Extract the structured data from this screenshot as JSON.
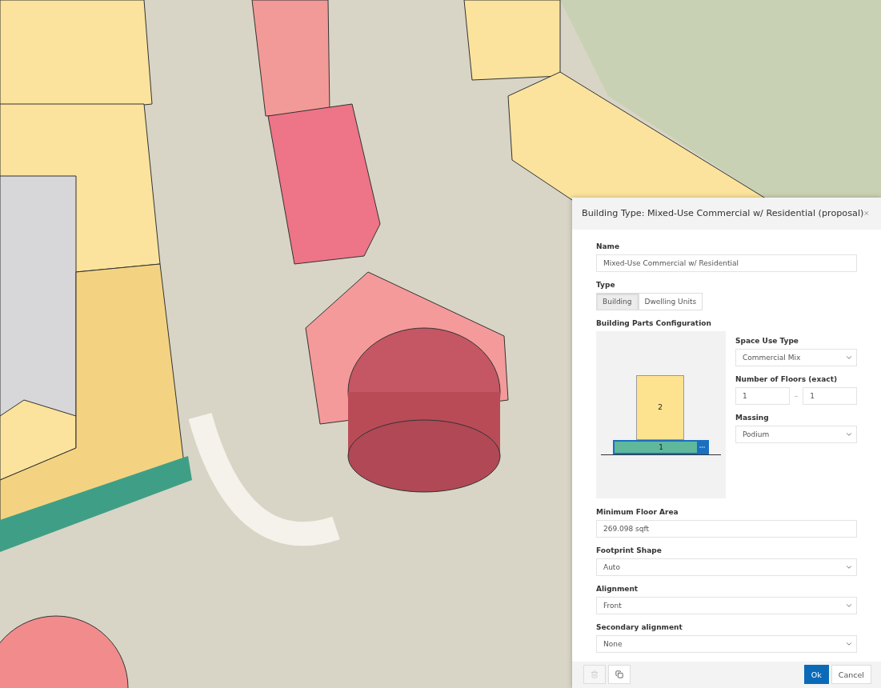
{
  "dialog": {
    "title": "Building Type: Mixed-Use Commercial w/ Residential (proposal)",
    "name": {
      "label": "Name",
      "value": "Mixed-Use Commercial w/ Residential"
    },
    "type": {
      "label": "Type",
      "options": [
        {
          "label": "Building",
          "selected": true
        },
        {
          "label": "Dwelling Units",
          "selected": false
        }
      ]
    },
    "configuration": {
      "label": "Building Parts Configuration",
      "parts": [
        {
          "label": "2",
          "color": "#fde28f",
          "selected": false
        },
        {
          "label": "1",
          "color": "#5fb89b",
          "selected": true
        }
      ],
      "space_use": {
        "label": "Space Use Type",
        "value": "Commercial Mix"
      },
      "floors": {
        "label": "Number of Floors (exact)",
        "min": "1",
        "separator": "–",
        "max": "1"
      },
      "massing": {
        "label": "Massing",
        "value": "Podium"
      }
    },
    "min_floor_area": {
      "label": "Minimum Floor Area",
      "value": "269.098 sqft"
    },
    "selects": [
      {
        "label": "Footprint Shape",
        "value": "Auto"
      },
      {
        "label": "Alignment",
        "value": "Front"
      },
      {
        "label": "Secondary alignment",
        "value": "None"
      }
    ],
    "footer": {
      "delete_disabled": true,
      "ok": "Ok",
      "cancel": "Cancel"
    }
  }
}
